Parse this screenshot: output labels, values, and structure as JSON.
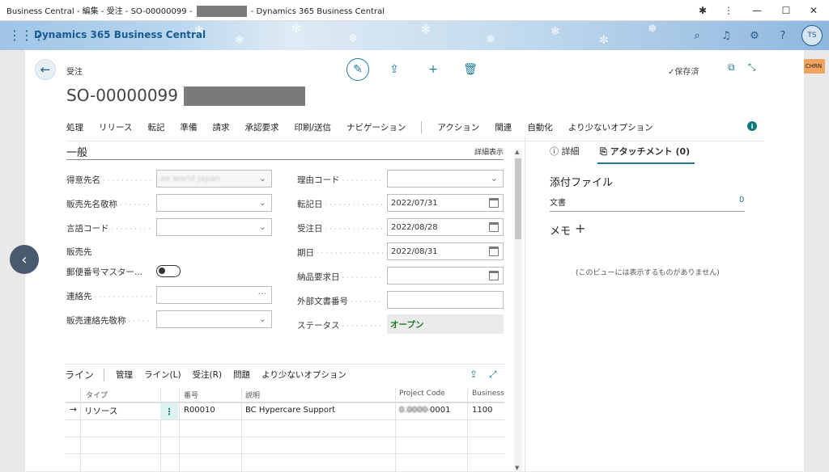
{
  "window": {
    "title_prefix": "Business Central - 編集 - 受注 - SO-00000099 -",
    "title_suffix": "- Dynamics 365 Business Central",
    "controls": {
      "ext": "✱",
      "menu": "⋮",
      "min": "—",
      "max": "☐",
      "close": "✕"
    }
  },
  "appbar": {
    "brand": "Dynamics 365 Business Central",
    "avatar": "TS",
    "icons": [
      "search-icon",
      "bell-icon",
      "gear-icon",
      "help-icon"
    ]
  },
  "badge": "CHRN",
  "page": {
    "breadcrumb": "受注",
    "title": "SO-00000099 ·",
    "saved": "✓保存済",
    "actions": [
      "処理",
      "リリース",
      "転記",
      "準備",
      "請求",
      "承認要求",
      "印刷/送信",
      "ナビゲーション"
    ],
    "actions2": [
      "アクション",
      "関連",
      "自動化",
      "より少ないオプション"
    ]
  },
  "general": {
    "title": "一般",
    "show_more": "詳細表示",
    "left_fields": [
      {
        "label": "得意先名",
        "value": "ae world Japan"
      },
      {
        "label": "販売先名敬称",
        "value": ""
      },
      {
        "label": "言語コード",
        "value": ""
      }
    ],
    "sold_to": "販売先",
    "postcode_label": "郵便番号マスター...",
    "contact_label": "連絡先",
    "contact_title_label": "販売連絡先敬称",
    "right_fields": [
      {
        "label": "理由コード",
        "value": ""
      },
      {
        "label": "転記日",
        "value": "2022/07/31"
      },
      {
        "label": "受注日",
        "value": "2022/08/28"
      },
      {
        "label": "期日",
        "value": "2022/08/31"
      },
      {
        "label": "納品要求日",
        "value": ""
      },
      {
        "label": "外部文書番号",
        "value": ""
      }
    ],
    "status_label": "ステータス",
    "status_value": "オープン"
  },
  "lines": {
    "title": "ライン",
    "items": [
      "管理",
      "ライン(L)",
      "受注(R)",
      "問題",
      "より少ないオプション"
    ],
    "columns": [
      "タイプ",
      "番号",
      "説明",
      "Project Code",
      "Business G"
    ],
    "row": {
      "type": "リソース",
      "no": "R00010",
      "desc": "BC Hypercare Support",
      "project": "0001",
      "business": "1100"
    }
  },
  "factbox": {
    "tab_details": "ⓘ 詳細",
    "tab_attach": "アタッチメント (0)",
    "attach_title": "添付ファイル",
    "doc_label": "文書",
    "doc_count": "0",
    "memo": "メモ",
    "empty": "(このビューには表示するものがありません)"
  }
}
